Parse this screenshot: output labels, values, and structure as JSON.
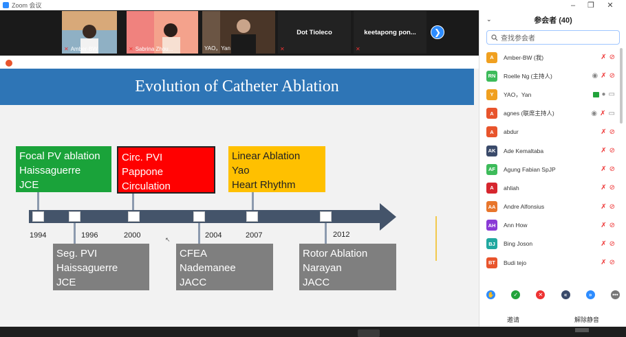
{
  "window": {
    "title": "Zoom 会议",
    "controls": [
      "–",
      "❐",
      "✕"
    ]
  },
  "video_strip": {
    "tiles": [
      {
        "name": "Amber-BW",
        "kind": "video",
        "bg": "#d79a6a"
      },
      {
        "name": "Sabrina Zhou...",
        "kind": "video",
        "bg": "#f4a28c"
      },
      {
        "name": "YAO，Yan",
        "kind": "video",
        "bg": "#3f2b1f"
      },
      {
        "name": "Dot Tioleco",
        "kind": "text"
      },
      {
        "name": "keetapong pon...",
        "kind": "text"
      }
    ],
    "next_arrow": "❯"
  },
  "slide": {
    "title": "Evolution of Catheter Ablation",
    "top_boxes": [
      {
        "text": "Focal PV ablation\nHaissaguerre\nJCE",
        "color": "green"
      },
      {
        "text": "Circ. PVI\nPappone\nCirculation",
        "color": "red"
      },
      {
        "text": "Linear Ablation\nYao\nHeart Rhythm",
        "color": "yellow"
      }
    ],
    "bottom_boxes": [
      {
        "text": "Seg. PVI\nHaissaguerre\nJCE"
      },
      {
        "text": "CFEA\nNademanee\nJACC"
      },
      {
        "text": "Rotor Ablation\nNarayan\nJACC"
      }
    ],
    "years": [
      "1994",
      "1996",
      "2000",
      "2004",
      "2007",
      "2012"
    ]
  },
  "participants_panel": {
    "title": "参会者 (40)",
    "collapse_icon": "⌄",
    "search_placeholder": "查找参会者",
    "participants": [
      {
        "initials": "A",
        "name": "Amber-BW (我)",
        "color": "#f0a020",
        "icons": [
          "mic-off",
          "cam-off"
        ]
      },
      {
        "initials": "RN",
        "name": "Roelle Ng (主持人)",
        "color": "#3dbb5a",
        "icons": [
          "share",
          "mic-off",
          "cam-off"
        ]
      },
      {
        "initials": "Y",
        "name": "YAO，Yan",
        "color": "#f0a020",
        "icons": [
          "video-green",
          "mic-on",
          "cam-on"
        ]
      },
      {
        "initials": "A",
        "name": "agnes (联席主持人)",
        "color": "#e8542c",
        "icons": [
          "share",
          "mic-off",
          "cam-on"
        ]
      },
      {
        "initials": "A",
        "name": "abdur",
        "color": "#e8542c",
        "icons": [
          "mic-off",
          "cam-off"
        ]
      },
      {
        "initials": "AK",
        "name": "Ade Kemaltaba",
        "color": "#3a4a6a",
        "icons": [
          "mic-off",
          "cam-off"
        ]
      },
      {
        "initials": "AF",
        "name": "Agung Fabian SpJP",
        "color": "#3dbb5a",
        "icons": [
          "mic-off",
          "cam-off"
        ]
      },
      {
        "initials": "A",
        "name": "ahliah",
        "color": "#d6262e",
        "icons": [
          "mic-off",
          "cam-off"
        ]
      },
      {
        "initials": "AA",
        "name": "Andre Alfonsius",
        "color": "#e8762c",
        "icons": [
          "mic-off",
          "cam-off"
        ]
      },
      {
        "initials": "AH",
        "name": "Ann How",
        "color": "#8a3ad6",
        "icons": [
          "mic-off",
          "cam-off"
        ]
      },
      {
        "initials": "BJ",
        "name": "Bing Joson",
        "color": "#20a8a0",
        "icons": [
          "mic-off",
          "cam-off"
        ]
      },
      {
        "initials": "BT",
        "name": "Budi tejo",
        "color": "#e8542c",
        "icons": [
          "mic-off",
          "cam-off"
        ]
      }
    ],
    "reactions": [
      {
        "icon": "raise-hand",
        "glyph": "✋",
        "color": "#2d8cff"
      },
      {
        "icon": "yes",
        "glyph": "✓",
        "color": "#22a33b"
      },
      {
        "icon": "no",
        "glyph": "✕",
        "color": "#e33"
      },
      {
        "icon": "slower",
        "glyph": "«",
        "color": "#3a4a6a"
      },
      {
        "icon": "faster",
        "glyph": "»",
        "color": "#2d8cff"
      },
      {
        "icon": "more",
        "glyph": "•••",
        "color": "#777"
      }
    ],
    "footer": {
      "invite": "邀请",
      "unmute_all": "解除静音"
    }
  }
}
